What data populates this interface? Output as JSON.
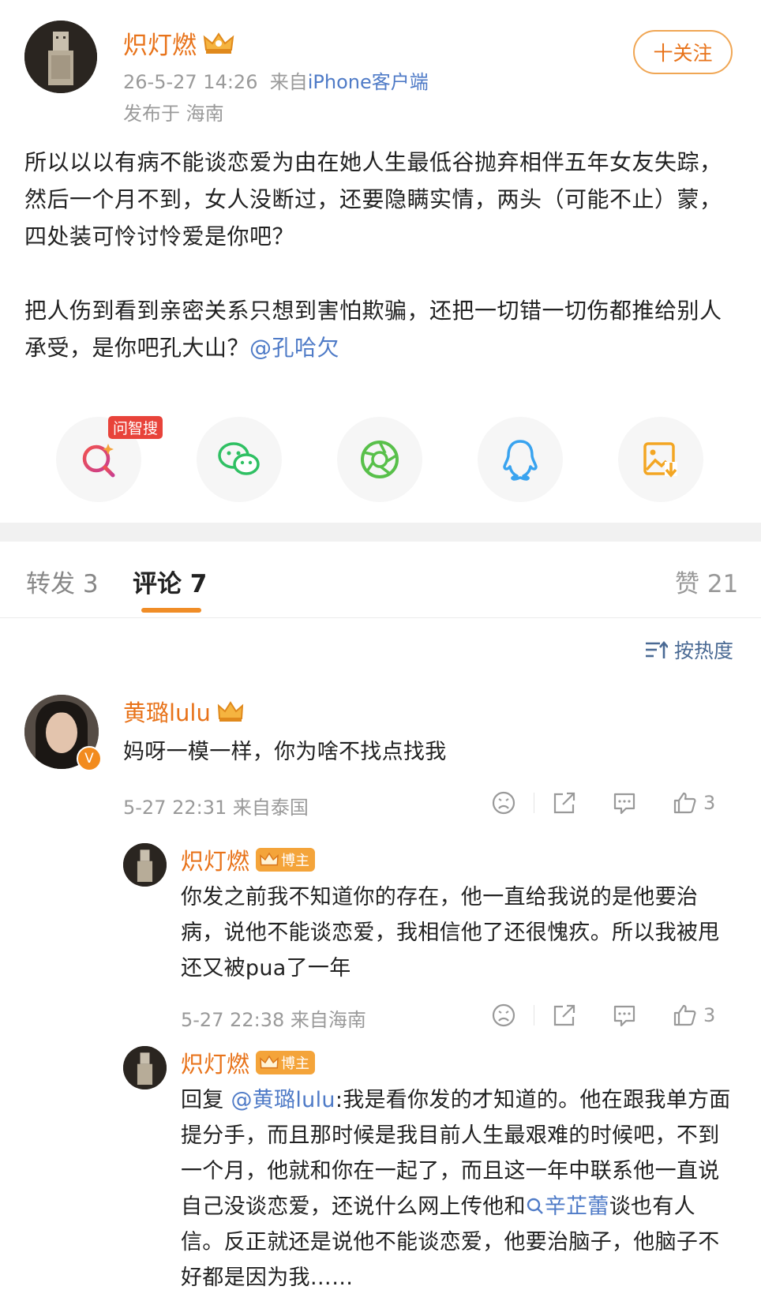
{
  "post": {
    "author": "炽灯燃",
    "time": "26-5-27 14:26",
    "from_prefix": "来自",
    "device": "iPhone客户端",
    "location": "发布于 海南",
    "follow_label": "十关注",
    "paragraph1": "所以以以有病不能谈恋爱为由在她人生最低谷抛弃相伴五年女友失踪，然后一个月不到，女人没断过，还要隐瞒实情，两头（可能不止）蒙，四处装可怜讨怜爱是你吧？",
    "paragraph2_text": "把人伤到看到亲密关系只想到害怕欺骗，还把一切错一切伤都推给别人承受，是你吧孔大山？",
    "paragraph2_mention": "@孔哈欠"
  },
  "share": {
    "ai_badge": "问智搜",
    "items": [
      "ai-search-icon",
      "wechat-icon",
      "moments-icon",
      "qq-icon",
      "save-image-icon"
    ]
  },
  "tabs": {
    "repost": "转发 3",
    "comment": "评论 7",
    "like": "赞 21"
  },
  "sort_label": "按热度",
  "comments": [
    {
      "name": "黄璐lulu",
      "text": "妈呀一模一样，你为啥不找点找我",
      "meta": "5-27 22:31 来自泰国",
      "likes": "3"
    }
  ],
  "replies": [
    {
      "name": "炽灯燃",
      "badge": "博主",
      "text": "你发之前我不知道你的存在，他一直给我说的是他要治病，说他不能谈恋爱，我相信他了还很愧疚。所以我被甩还又被pua了一年",
      "meta": "5-27 22:38 来自海南",
      "likes": "3"
    },
    {
      "name": "炽灯燃",
      "badge": "博主",
      "reply_prefix": "回复 ",
      "reply_mention": "@黄璐lulu",
      "text_part1": ":我是看你发的才知道的。他在跟我单方面提分手，而且那时候是我目前人生最艰难的时候吧，不到一个月，他就和你在一起了，而且这一年中联系他一直说自己没谈恋爱，还说什么网上传他和",
      "search_topic": "辛芷蕾",
      "text_part2": "谈也有人信。反正就还是说他不能谈恋爱，他要治脑子，他脑子不好都是因为我……"
    }
  ]
}
